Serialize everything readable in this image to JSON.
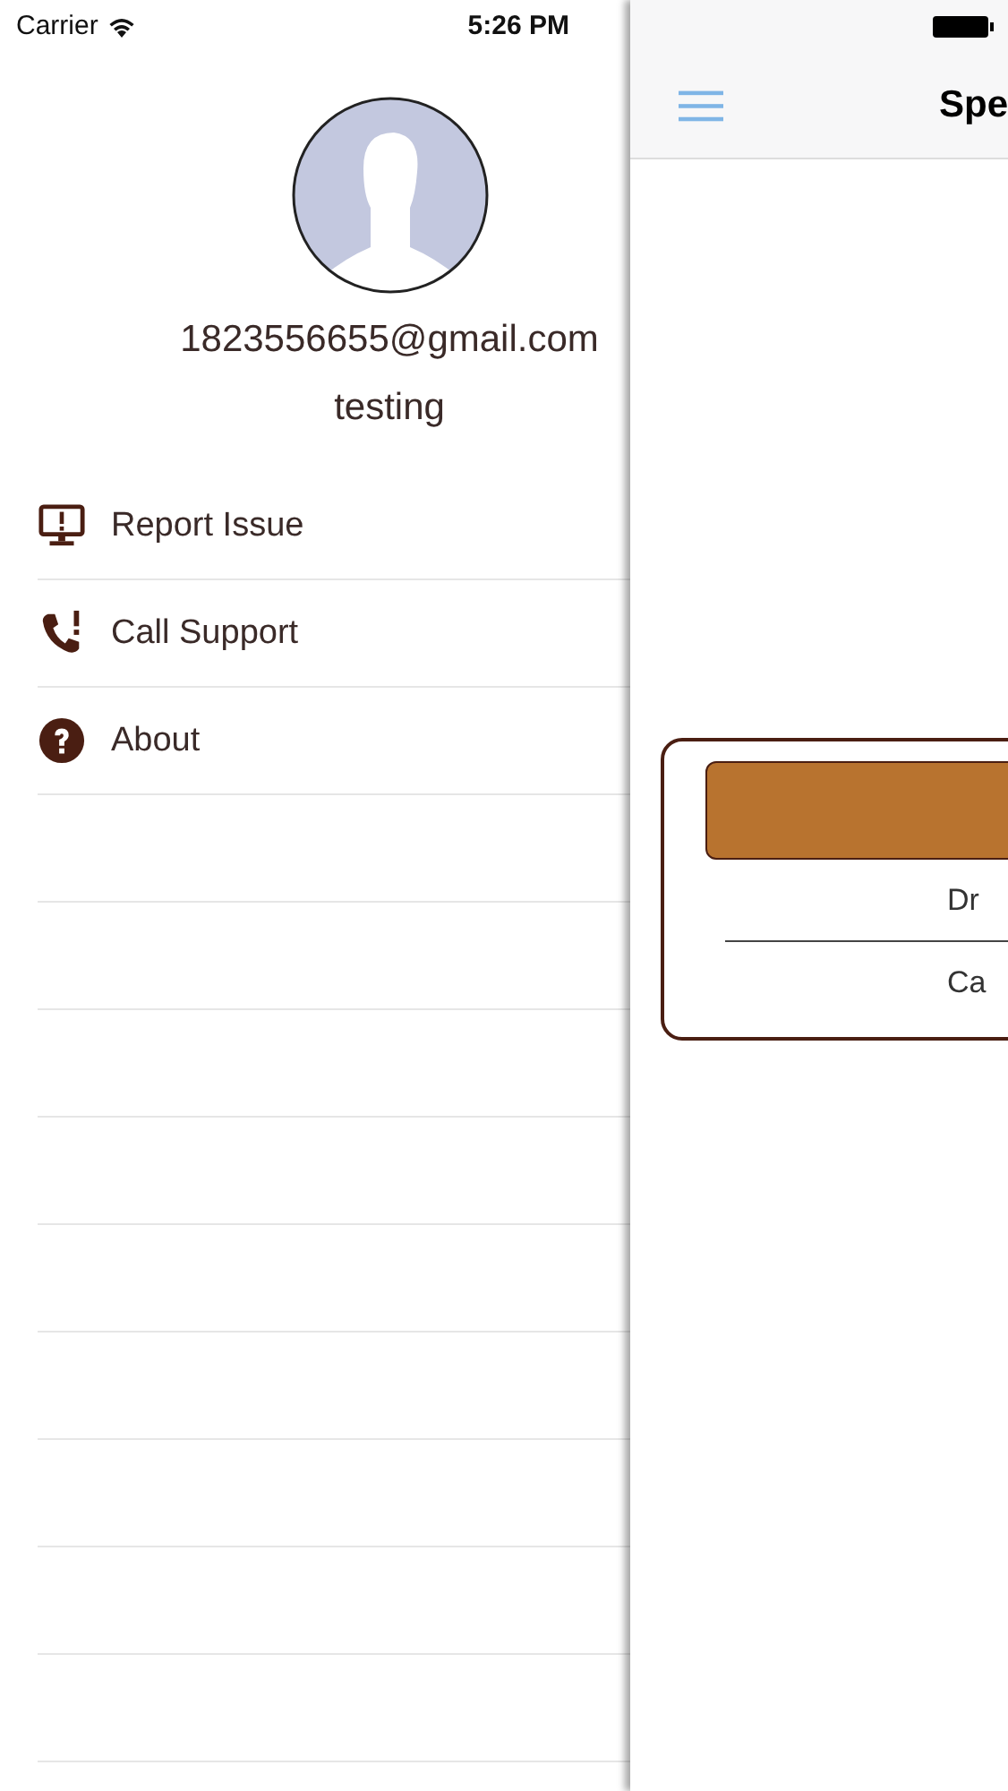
{
  "status_bar": {
    "carrier": "Carrier",
    "time": "5:26 PM"
  },
  "drawer": {
    "email": "1823556655@gmail.com",
    "name": "testing",
    "menu": [
      {
        "kind": "report",
        "label": "Report Issue"
      },
      {
        "kind": "call",
        "label": "Call Support"
      },
      {
        "kind": "about",
        "label": "About"
      }
    ]
  },
  "main": {
    "title": "Spe",
    "card": {
      "rows": [
        "Dr",
        "Ca"
      ]
    }
  }
}
